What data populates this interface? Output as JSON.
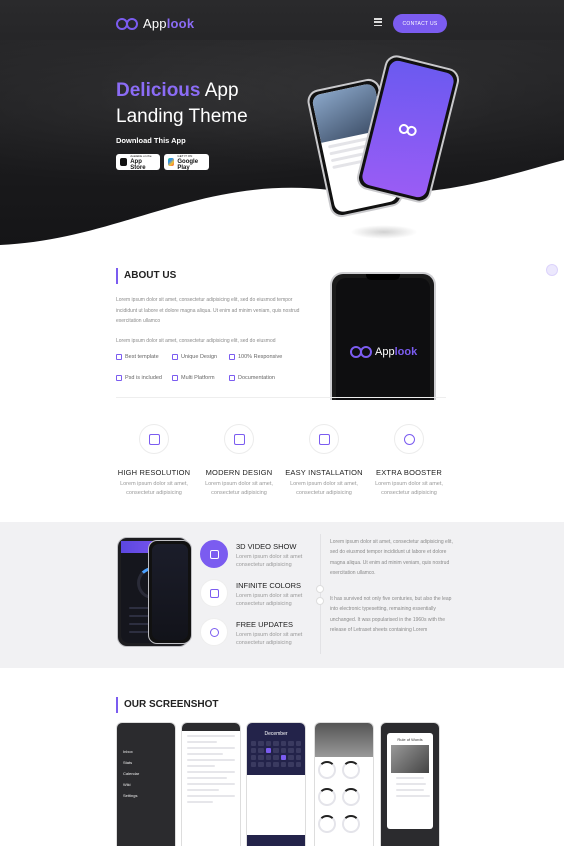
{
  "brand": {
    "name_prefix": "App",
    "name_accent": "look",
    "accent_color": "#7b5cf0"
  },
  "nav": {
    "contact_label": "CONTACT US"
  },
  "hero": {
    "title_accent": "Delicious",
    "title_rest_line1": " App",
    "title_line2": "Landing Theme",
    "download_label": "Download This App",
    "appstore": {
      "small": "Available on the",
      "big": "App Store"
    },
    "googleplay": {
      "small": "GET IT ON",
      "big": "Google Play"
    }
  },
  "about": {
    "title_bold": "ABOUT",
    "title_rest": " US",
    "para1": "Lorem ipsum dolor sit amet, consectetur adipisicing elit, sed do eiusmod tempor incididunt ut labore et dolore magna aliqua. Ut enim ad minim veniam, quis nostrud exercitation ullamco",
    "para2": "Lorem ipsum dolor sit amet, consectetur adipisicing elit, sed do eiusmod",
    "features": [
      "Best template",
      "Unique Design",
      "100% Responsive",
      "Psd is included",
      "Multi Platform",
      "Documentation"
    ],
    "phone_logo_prefix": "App",
    "phone_logo_accent": "look"
  },
  "features": [
    {
      "title": "HIGH RESOLUTION",
      "desc": "Lorem ipsum dolor sit amet, consectetur adipisicing"
    },
    {
      "title": "MODERN DESIGN",
      "desc": "Lorem ipsum dolor sit amet, consectetur adipisicing"
    },
    {
      "title": "EASY INSTALLATION",
      "desc": "Lorem ipsum dolor sit amet, consectetur adipisicing"
    },
    {
      "title": "EXTRA BOOSTER",
      "desc": "Lorem ipsum dolor sit amet, consectetur adipisicing"
    }
  ],
  "services": [
    {
      "title": "3D VIDEO SHOW",
      "desc": "Lorem ipsum dolor sit amet consectetur adipisicing"
    },
    {
      "title": "INFINITE COLORS",
      "desc": "Lorem ipsum dolor sit amet consectetur adipisicing"
    },
    {
      "title": "FREE UPDATES",
      "desc": "Lorem ipsum dolor sit amet consectetur adipisicing"
    }
  ],
  "services_text": {
    "para1": "Lorem ipsum dolor sit amet, consectetur adipisicing elit, sed do eiusmod tempor incididunt ut labore et dolore magna aliqua. Ut enim ad minim veniam, quis nostrud exercitation ullamco.",
    "para2": "It has survived not only five centuries, but also the leap into electronic typesetting, remaining essentially unchanged. It was popularised in the 1960s with the release of Letraset sheets containing Lorem"
  },
  "screenshots": {
    "title_bold": "OUR",
    "title_rest": " SCREENSHOT",
    "menu_items": [
      "Inbox",
      "Stats",
      "Calendar",
      "Wiki",
      "Settings"
    ],
    "calendar_month": "December",
    "quote_title": "Rule of Words"
  }
}
